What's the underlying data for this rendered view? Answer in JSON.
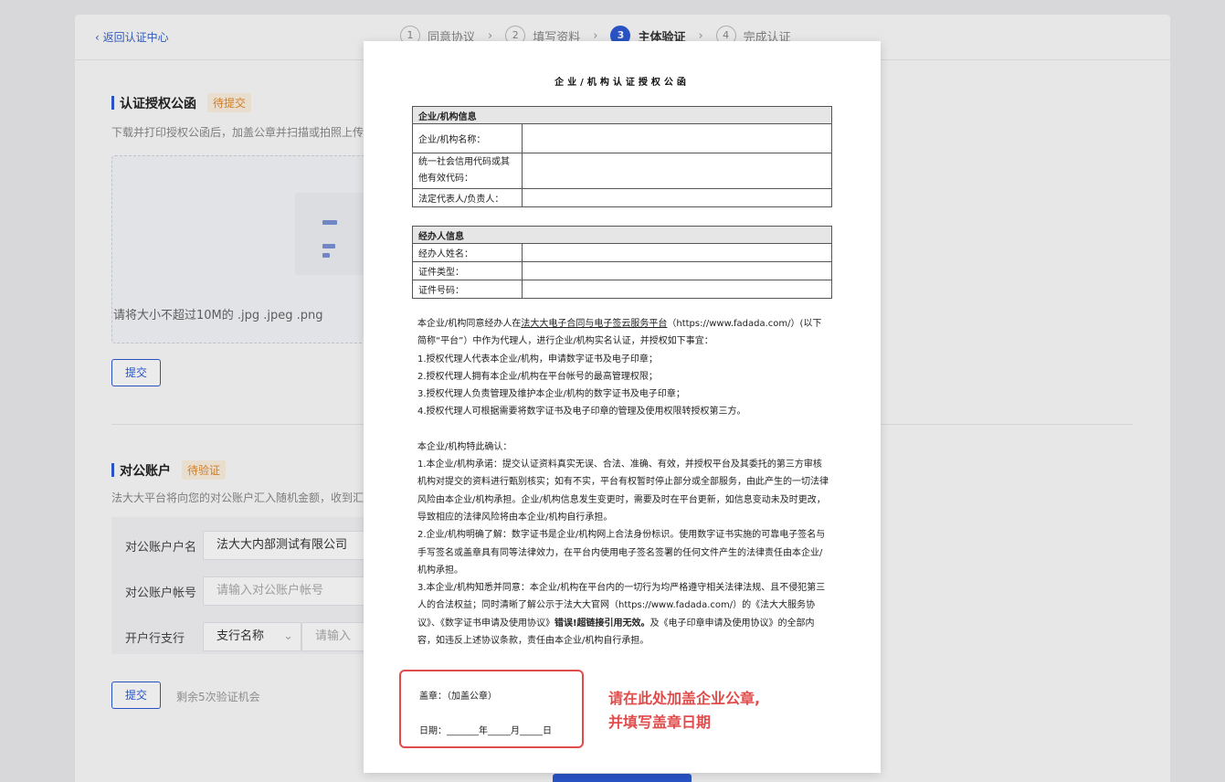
{
  "background": {
    "back_label": "返回认证中心",
    "steps": [
      {
        "num": "1",
        "label": "同意协议"
      },
      {
        "num": "2",
        "label": "填写资料"
      },
      {
        "num": "3",
        "label": "主体验证"
      },
      {
        "num": "4",
        "label": "完成认证"
      }
    ],
    "step_sep": "›",
    "auth_letter": {
      "title": "认证授权公函",
      "badge": "待提交",
      "desc": "下载并打印授权公函后，加盖公章并扫描或拍照上传",
      "upload_hint": "请将大小不超过10M的 .jpg .jpeg .png",
      "submit": "提交"
    },
    "bank": {
      "title": "对公账户",
      "badge": "待验证",
      "desc": "法大大平台将向您的对公账户汇入随机金额，收到汇",
      "name_label": "对公账户户名",
      "name_value": "法大大内部测试有限公司",
      "account_label": "对公账户帐号",
      "account_placeholder": "请输入对公账户帐号",
      "branch_label": "开户行支行",
      "branch_select": "支行名称",
      "branch_input": "请输入",
      "submit": "提交",
      "remaining": "剩余5次验证机会"
    }
  },
  "document": {
    "title": "企业/机构认证授权公函",
    "org_table": {
      "header": "企业/机构信息",
      "rows": [
        "企业/机构名称：",
        "统一社会信用代码或其他有效代码：",
        "法定代表人/负责人："
      ]
    },
    "agent_table": {
      "header": "经办人信息",
      "rows": [
        "经办人姓名：",
        "证件类型：",
        "证件号码："
      ]
    },
    "para1_pre": "本企业/机构同意经办人在",
    "para1_link": "法大大电子合同与电子签云服务平台",
    "para1_post": "（https://www.fadada.com/）(以下简称“平台”）中作为代理人，进行企业/机构实名认证，并授权如下事宜：",
    "auth_items": [
      "1.授权代理人代表本企业/机构，申请数字证书及电子印章；",
      "2.授权代理人拥有本企业/机构在平台帐号的最高管理权限；",
      "3.授权代理人负责管理及维护本企业/机构的数字证书及电子印章；",
      "4.授权代理人可根据需要将数字证书及电子印章的管理及使用权限转授权第三方。"
    ],
    "confirm_title": "本企业/机构特此确认：",
    "confirm_1": "1.本企业/机构承诺：提交认证资料真实无误、合法、准确、有效，并授权平台及其委托的第三方审核机构对提交的资料进行甄别核实；如有不实，平台有权暂时停止部分或全部服务，由此产生的一切法律风险由本企业/机构承担。企业/机构信息发生变更时，需要及时在平台更新，如信息变动未及时更改，导致相应的法律风险将由本企业/机构自行承担。",
    "confirm_2": "2.企业/机构明确了解：数字证书是企业/机构网上合法身份标识。使用数字证书实施的可靠电子签名与手写签名或盖章具有同等法律效力，在平台内使用电子签名签署的任何文件产生的法律责任由本企业/机构承担。",
    "confirm_3_pre": "3.本企业/机构知悉并同意：本企业/机构在平台内的一切行为均严格遵守相关法律法规、且不侵犯第三人的合法权益；同时清晰了解公示于法大大官网（https://www.fadada.com/）的《法大大服务协议》、《数字证书申请及使用协议》",
    "confirm_3_bold": "错误!超链接引用无效。",
    "confirm_3_post": "及《电子印章申请及使用协议》的全部内容，如违反上述协议条款，责任由本企业/机构自行承担。",
    "seal_label": "盖章：（加盖公章）",
    "date_label": "日期：_______年_____月_____日"
  },
  "annotation": {
    "line1": "请在此处加盖企业公章,",
    "line2": "并填写盖章日期"
  },
  "colors": {
    "primary": "#2d5bd6",
    "warning": "#e08a2e",
    "annotation": "#e24b4b"
  }
}
